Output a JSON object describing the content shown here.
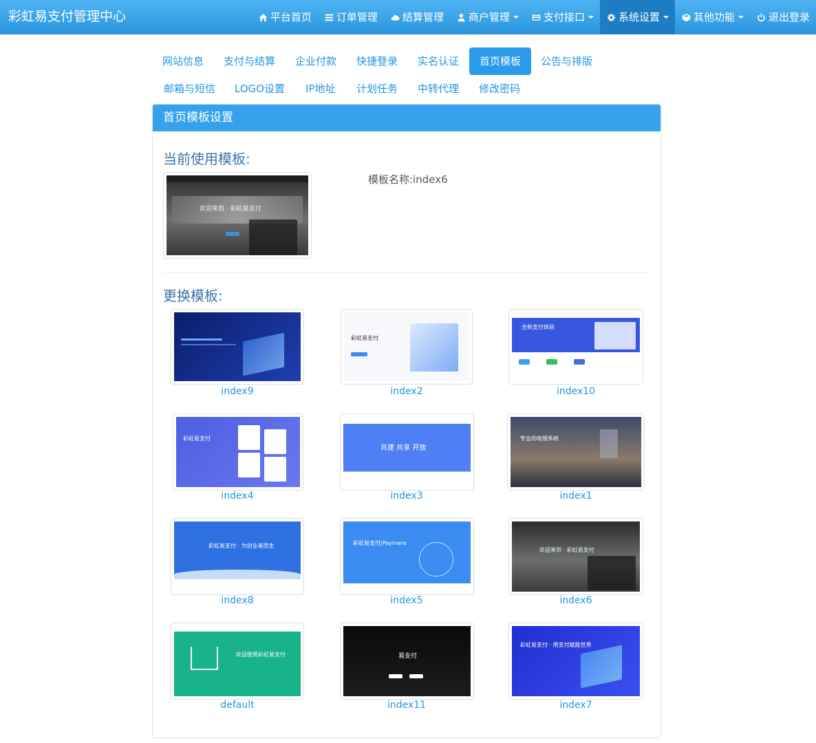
{
  "brand": "彩虹易支付管理中心",
  "nav": [
    {
      "label": "平台首页",
      "icon": "home-icon",
      "dropdown": false
    },
    {
      "label": "订单管理",
      "icon": "list-icon",
      "dropdown": false
    },
    {
      "label": "结算管理",
      "icon": "cloud-icon",
      "dropdown": false
    },
    {
      "label": "商户管理",
      "icon": "user-icon",
      "dropdown": true
    },
    {
      "label": "支付接口",
      "icon": "credit-card-icon",
      "dropdown": true
    },
    {
      "label": "系统设置",
      "icon": "gear-icon",
      "dropdown": true,
      "active": true
    },
    {
      "label": "其他功能",
      "icon": "cube-icon",
      "dropdown": true
    },
    {
      "label": "退出登录",
      "icon": "power-icon",
      "dropdown": false
    }
  ],
  "tabs": [
    {
      "label": "网站信息"
    },
    {
      "label": "支付与结算"
    },
    {
      "label": "企业付款"
    },
    {
      "label": "快捷登录"
    },
    {
      "label": "实名认证"
    },
    {
      "label": "首页模板",
      "active": true
    },
    {
      "label": "公告与排版"
    },
    {
      "label": "邮箱与短信"
    },
    {
      "label": "LOGO设置"
    },
    {
      "label": "IP地址"
    },
    {
      "label": "计划任务"
    },
    {
      "label": "中转代理"
    },
    {
      "label": "修改密码"
    }
  ],
  "panel": {
    "title": "首页模板设置",
    "current_title": "当前使用模板:",
    "current_name_label": "模板名称:index6",
    "change_title": "更换模板:"
  },
  "templates": [
    {
      "name": "index9"
    },
    {
      "name": "index2"
    },
    {
      "name": "index10"
    },
    {
      "name": "index4"
    },
    {
      "name": "index3"
    },
    {
      "name": "index1"
    },
    {
      "name": "index8"
    },
    {
      "name": "index5"
    },
    {
      "name": "index6"
    },
    {
      "name": "default"
    },
    {
      "name": "index11"
    },
    {
      "name": "index7"
    }
  ],
  "preview_text": {
    "index2": "彩虹易支付",
    "index10": "全新支付体验",
    "index4": "彩虹易支付",
    "index3": "共建  共享  开放",
    "index1": "专业的收银系统",
    "index8": "彩虹易支付 · 为创业者而生",
    "index5": "彩虹易支付|Paymere",
    "index6": "欢迎来到 · 彩虹易支付",
    "default": "欢迎使用彩虹易支付",
    "index11": "易支付",
    "index7": "彩虹易支付 · 用支付赋能世界"
  }
}
